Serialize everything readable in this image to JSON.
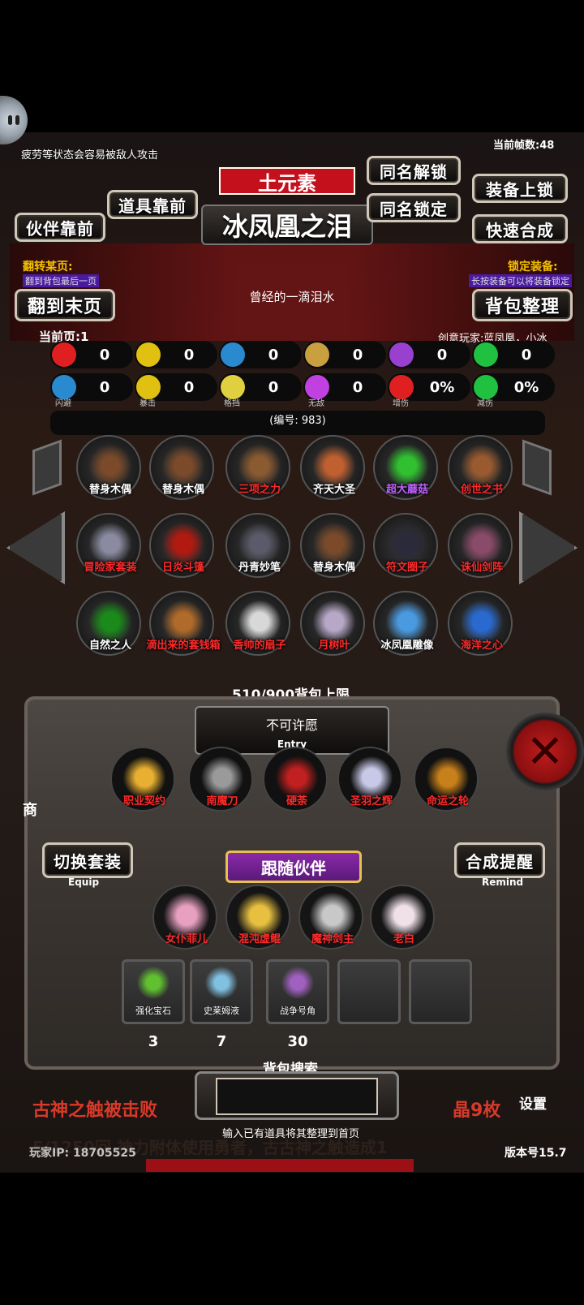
{
  "status_hint": "疲劳等状态会容易被敌人攻击",
  "fps_label": "当前帧数:48",
  "element_banner": "土元素",
  "item_title": "冰凤凰之泪",
  "buttons": {
    "partner_front": "伙伴靠前",
    "item_front": "道具靠前",
    "same_name_unlock": "同名解锁",
    "same_name_lock": "同名锁定",
    "equip_lock": "装备上锁",
    "quick_merge": "快速合成",
    "to_last_page": "翻到末页",
    "bag_sort": "背包整理",
    "switch_outfit": "切换套装",
    "merge_remind": "合成提醒"
  },
  "flip_page_label": "翻转某页:",
  "flip_page_hint": "翻到背包最后一页",
  "lock_equip_label": "锁定装备:",
  "lock_equip_hint": "长按装备可以将装备锁定",
  "item_desc": "曾经的一滴泪水",
  "current_page": "当前页:1",
  "author": "创意玩家:蓝凤凰，小冰",
  "stats": [
    {
      "icon": "heart-icon",
      "color": "#e02020",
      "value": "0"
    },
    {
      "icon": "strength-icon",
      "color": "#e0c010",
      "value": "0"
    },
    {
      "icon": "helmet-icon",
      "color": "#2a8ad0",
      "value": "0"
    },
    {
      "icon": "sword-icon",
      "color": "#c8a040",
      "value": "0"
    },
    {
      "icon": "lightning-icon",
      "color": "#9a40d0",
      "value": "0"
    },
    {
      "icon": "clover-icon",
      "color": "#20c040",
      "value": "0"
    },
    {
      "icon": "dodge-icon",
      "color": "#2a8ad0",
      "value": "0",
      "cap": "闪避"
    },
    {
      "icon": "crit-icon",
      "color": "#e0c010",
      "value": "0",
      "cap": "暴击"
    },
    {
      "icon": "block-icon",
      "color": "#e0d040",
      "value": "0",
      "cap": "格挡"
    },
    {
      "icon": "invincible-icon",
      "color": "#c040e0",
      "value": "0",
      "cap": "无敌"
    },
    {
      "icon": "damage-up-icon",
      "color": "#e02020",
      "value": "0%",
      "cap": "增伤"
    },
    {
      "icon": "damage-down-icon",
      "color": "#20c040",
      "value": "0%",
      "cap": "减伤"
    }
  ],
  "serial_label": "(编号:  983)",
  "inventory": [
    {
      "name": "替身木偶",
      "color": "#7a4a2a",
      "text_color": "#ffffff"
    },
    {
      "name": "替身木偶",
      "color": "#7a4a2a",
      "text_color": "#ffffff"
    },
    {
      "name": "三项之力",
      "color": "#8a5a30",
      "text_color": "#ff2a2a"
    },
    {
      "name": "齐天大圣",
      "color": "#c06030",
      "text_color": "#ffffff"
    },
    {
      "name": "超大蘑菇",
      "color": "#30c030",
      "text_color": "#c060ff"
    },
    {
      "name": "创世之书",
      "color": "#9a5a30",
      "text_color": "#ff2a2a"
    },
    {
      "name": "冒险家套装",
      "color": "#8a8aa0",
      "text_color": "#ff2a2a"
    },
    {
      "name": "日炎斗篷",
      "color": "#b01a10",
      "text_color": "#ff2a2a"
    },
    {
      "name": "丹青妙笔",
      "color": "#5a5a6a",
      "text_color": "#ffffff"
    },
    {
      "name": "替身木偶",
      "color": "#7a4a2a",
      "text_color": "#ffffff"
    },
    {
      "name": "符文圈子",
      "color": "#2a2a3a",
      "text_color": "#ff2a2a"
    },
    {
      "name": "诛仙剑阵",
      "color": "#8a4a6a",
      "text_color": "#ff2a2a"
    },
    {
      "name": "自然之人",
      "color": "#1a8a1a",
      "text_color": "#ffffff"
    },
    {
      "name": "滴出来的套钱箱",
      "color": "#b06a2a",
      "text_color": "#ff2a2a"
    },
    {
      "name": "香帅的扇子",
      "color": "#d8d8d8",
      "text_color": "#ff2a2a"
    },
    {
      "name": "月树叶",
      "color": "#b8a8c8",
      "text_color": "#ff2a2a"
    },
    {
      "name": "冰凤凰雕像",
      "color": "#4a9ae0",
      "text_color": "#ffffff"
    },
    {
      "name": "海洋之心",
      "color": "#2a6ad0",
      "text_color": "#ff2a2a"
    }
  ],
  "bag_capacity": "510/900背包上限",
  "entry_title": "不可许愿",
  "entry_sub": "Entry",
  "equipped": [
    {
      "name": "职业契约",
      "color": "#e8b030"
    },
    {
      "name": "南魔刀",
      "color": "#9a9a9a"
    },
    {
      "name": "硬荼",
      "color": "#c02020"
    },
    {
      "name": "圣羽之辉",
      "color": "#c8c8e8"
    },
    {
      "name": "命运之轮",
      "color": "#c8801a"
    }
  ],
  "equip_sub": "Equip",
  "remind_sub": "Remind",
  "follow_title": "跟随伙伴",
  "partners": [
    {
      "name": "女仆菲儿",
      "color": "#e8a0c0"
    },
    {
      "name": "混沌虚鲲",
      "color": "#e8c040"
    },
    {
      "name": "魔神剑主",
      "color": "#c8c8c8"
    },
    {
      "name": "老白",
      "color": "#f0e0e8"
    }
  ],
  "consumables": [
    {
      "name": "强化宝石",
      "color": "#60c030",
      "count": "3"
    },
    {
      "name": "史莱姆液",
      "color": "#80c0e0",
      "count": "7"
    },
    {
      "name": "战争号角",
      "color": "#a060c0",
      "count": "30"
    }
  ],
  "search_label": "背包搜索",
  "search_hint": "输入已有道具将其整理到首页",
  "ticker_left": "古神之触被击败",
  "ticker_right": "晶9枚",
  "ticker_bottom": "5/1250回 神力附体使用勇者，古古神之触造成1",
  "player_ip": "玩家IP:  18705525",
  "version": "版本号15.7",
  "settings_label": "设置",
  "shop_label": "商"
}
